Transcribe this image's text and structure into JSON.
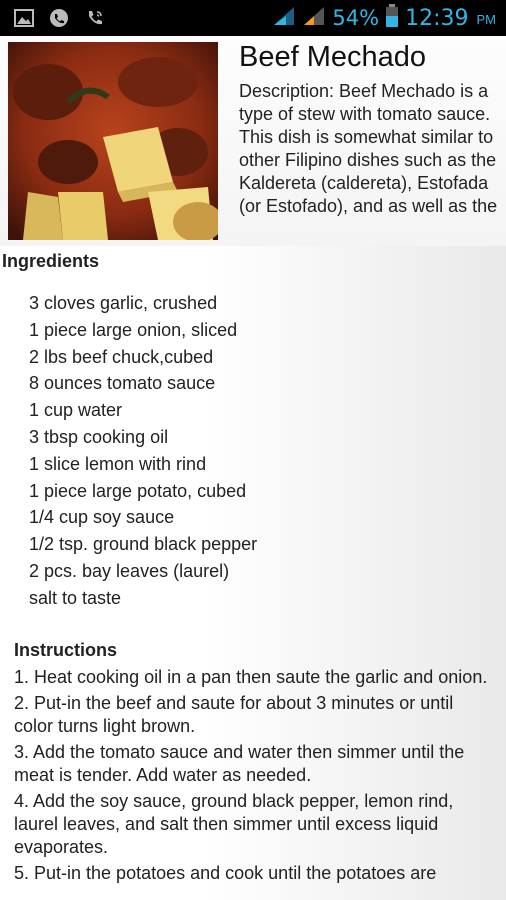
{
  "status_bar": {
    "battery": "54%",
    "time": "12:39",
    "ampm": "PM",
    "icons": [
      "image-icon",
      "viber-icon",
      "phone-call-icon",
      "signal-icon",
      "signal-icon-2",
      "battery-icon"
    ]
  },
  "recipe": {
    "title": "Beef Mechado",
    "description": "Description: Beef Mechado is a type of stew with tomato sauce. This dish is somewhat similar to other Filipino dishes such as the Kaldereta (caldereta), Estofada (or Estofado), and as well as the"
  },
  "ingredients": {
    "heading": "Ingredients",
    "items": [
      "3 cloves garlic, crushed",
      "1 piece large onion, sliced",
      "2 lbs beef chuck,cubed",
      "8 ounces tomato sauce",
      "1 cup water",
      "3 tbsp cooking oil",
      "1 slice lemon with rind",
      "1 piece large potato, cubed",
      "1/4 cup soy sauce",
      "1/2 tsp. ground black pepper",
      "2 pcs. bay leaves (laurel)",
      "salt to taste"
    ]
  },
  "instructions": {
    "heading": "Instructions",
    "steps": [
      "1. Heat cooking oil in a pan then saute the garlic and onion.",
      "2. Put-in the beef and saute for about 3 minutes or until color turns light brown.",
      "3. Add the tomato sauce and water then simmer until the meat is tender. Add water as needed.",
      "4. Add the soy sauce, ground black pepper, lemon rind, laurel leaves, and salt then simmer until excess liquid evaporates.",
      "5. Put-in the potatoes and cook until the potatoes are"
    ]
  },
  "colors": {
    "status_accent": "#33b5e5",
    "signal_warning": "#f39c12"
  }
}
